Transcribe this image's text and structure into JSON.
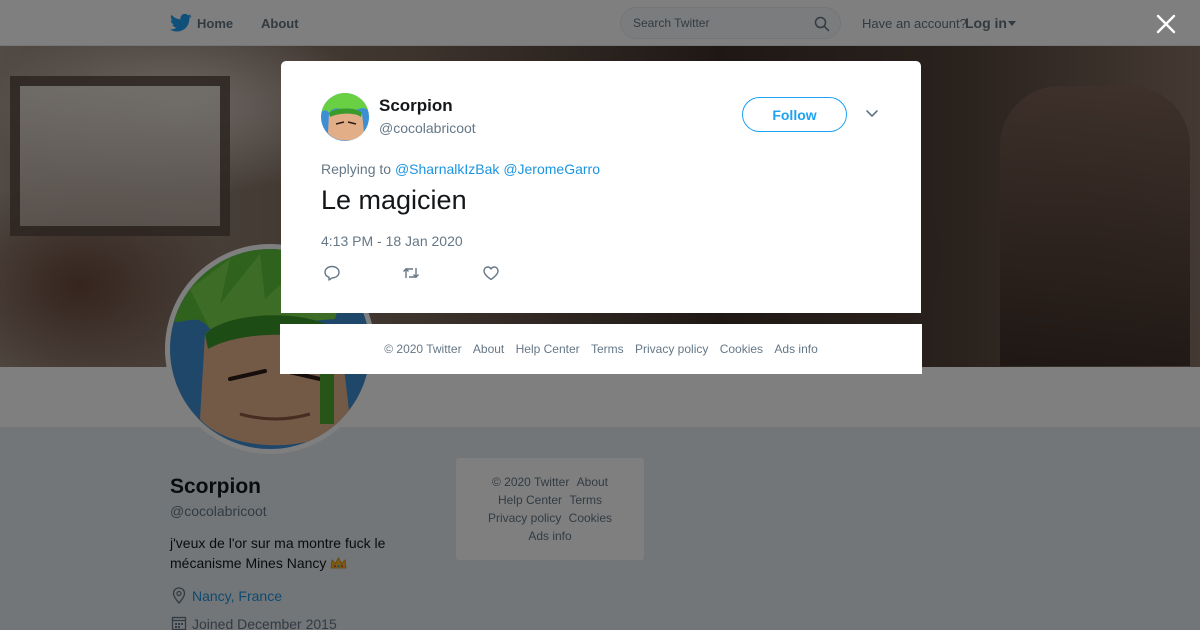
{
  "nav": {
    "home": "Home",
    "about": "About",
    "search_placeholder": "Search Twitter",
    "have_account": "Have an account?",
    "login": "Log in"
  },
  "profile": {
    "name": "Scorpion",
    "handle": "@cocolabricoot",
    "bio": "j'veux de l'or sur ma montre fuck le mécanisme Mines Nancy",
    "location": "Nancy, France",
    "joined": "Joined December 2015"
  },
  "side_footer": {
    "copyright": "© 2020 Twitter",
    "about": "About",
    "help": "Help Center",
    "terms": "Terms",
    "privacy": "Privacy policy",
    "cookies": "Cookies",
    "ads": "Ads info"
  },
  "tweet": {
    "author_name": "Scorpion",
    "author_handle": "@cocolabricoot",
    "follow_label": "Follow",
    "replying_prefix": "Replying to",
    "reply_to": [
      "@SharnalkIzBak",
      "@JeromeGarro"
    ],
    "text": "Le magicien",
    "timestamp": "4:13 PM - 18 Jan 2020"
  },
  "modal_footer": {
    "copyright": "© 2020 Twitter",
    "about": "About",
    "help": "Help Center",
    "terms": "Terms",
    "privacy": "Privacy policy",
    "cookies": "Cookies",
    "ads": "Ads info"
  },
  "icons": {
    "logo": "twitter-bird-icon",
    "search": "search-icon",
    "close": "close-icon",
    "chevron": "chevron-down-icon",
    "reply": "reply-icon",
    "retweet": "retweet-icon",
    "like": "heart-icon",
    "location": "location-pin-icon",
    "calendar": "calendar-icon"
  },
  "colors": {
    "brand": "#1da1f2",
    "link": "#1b95e0",
    "muted": "#657786"
  }
}
